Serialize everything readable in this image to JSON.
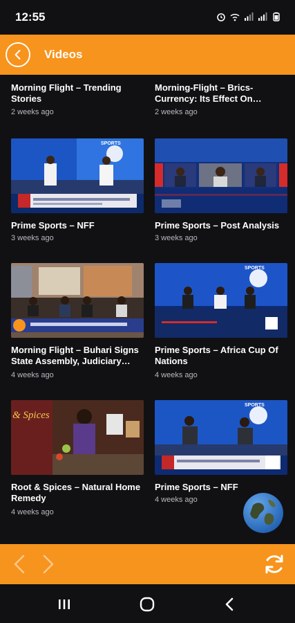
{
  "status": {
    "time": "12:55"
  },
  "header": {
    "title": "Videos"
  },
  "videos": [
    {
      "title": "Morning Flight – Trending Stories",
      "age": "2 weeks ago"
    },
    {
      "title": "Morning-Flight – Brics-Currency: Its Effect On…",
      "age": "2 weeks ago"
    },
    {
      "title": "Prime Sports – NFF",
      "age": "3 weeks ago"
    },
    {
      "title": "Prime Sports – Post Analysis",
      "age": "3 weeks ago"
    },
    {
      "title": "Morning Flight – Buhari Signs State Assembly, Judiciary…",
      "age": "4 weeks ago"
    },
    {
      "title": "Prime Sports – Africa Cup Of Nations",
      "age": "4 weeks ago"
    },
    {
      "title": "Root & Spices – Natural Home Remedy",
      "age": "4 weeks ago"
    },
    {
      "title": "Prime Sports – NFF",
      "age": "4 weeks ago"
    }
  ],
  "thumbnails": {
    "sports_label": "SPORTS",
    "roots_label": "& Spices"
  },
  "colors": {
    "accent": "#f7941d",
    "background": "#111114",
    "muted_text": "#b9b9bf"
  },
  "icons": {
    "back": "chevron-left-circle-icon",
    "prev": "chevron-left-icon",
    "next": "chevron-right-icon",
    "refresh": "refresh-icon",
    "globe": "globe-icon",
    "recents": "recents-icon",
    "home": "home-icon",
    "system_back": "system-back-icon"
  }
}
